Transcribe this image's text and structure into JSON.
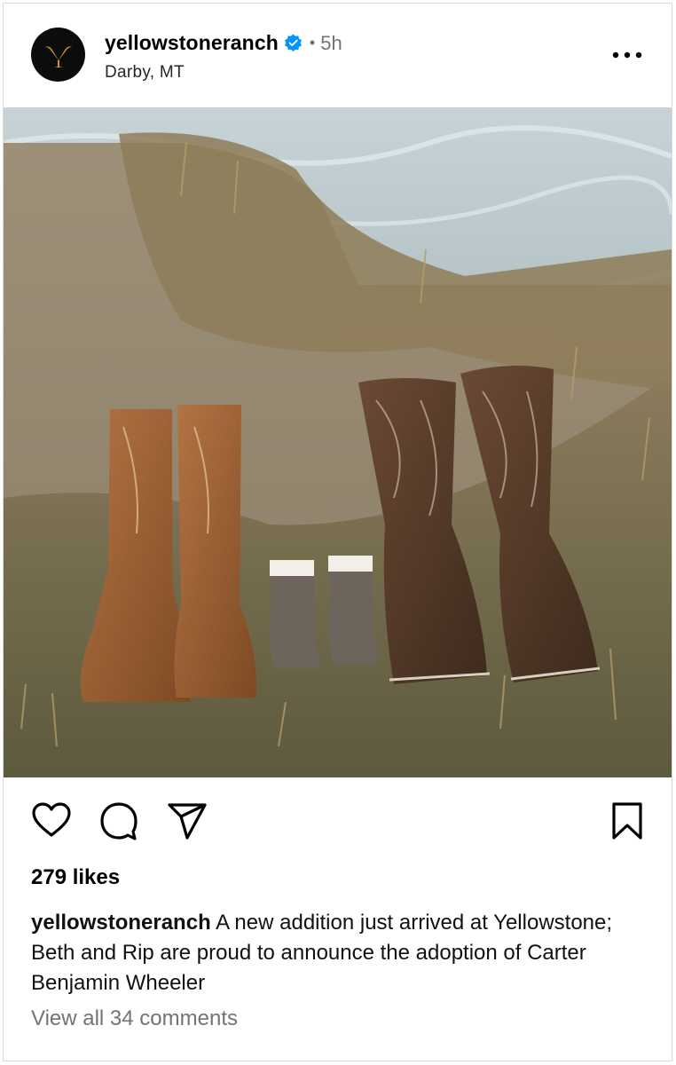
{
  "post": {
    "username": "yellowstoneranch",
    "verified": true,
    "separator": "•",
    "time": "5h",
    "location": "Darby, MT",
    "avatar_icon": "yellowstone-y-logo",
    "more_icon": "more-options-icon",
    "image_alt": "Two adult pairs of cowboy boots with a tiny pair of baby boots between them on a grassy cliff above the ocean"
  },
  "actions": {
    "like_icon": "heart-icon",
    "comment_icon": "comment-icon",
    "share_icon": "share-icon",
    "save_icon": "bookmark-icon"
  },
  "likes": "279 likes",
  "caption": {
    "username": "yellowstoneranch",
    "text": "A new addition just arrived at Yellowstone; Beth and Rip are proud to announce the adoption of Carter Benjamin Wheeler"
  },
  "comments_link": "View all 34 comments",
  "colors": {
    "verified_blue": "#0095f6",
    "secondary_text": "#737373",
    "logo_gold": "#c9952c"
  }
}
